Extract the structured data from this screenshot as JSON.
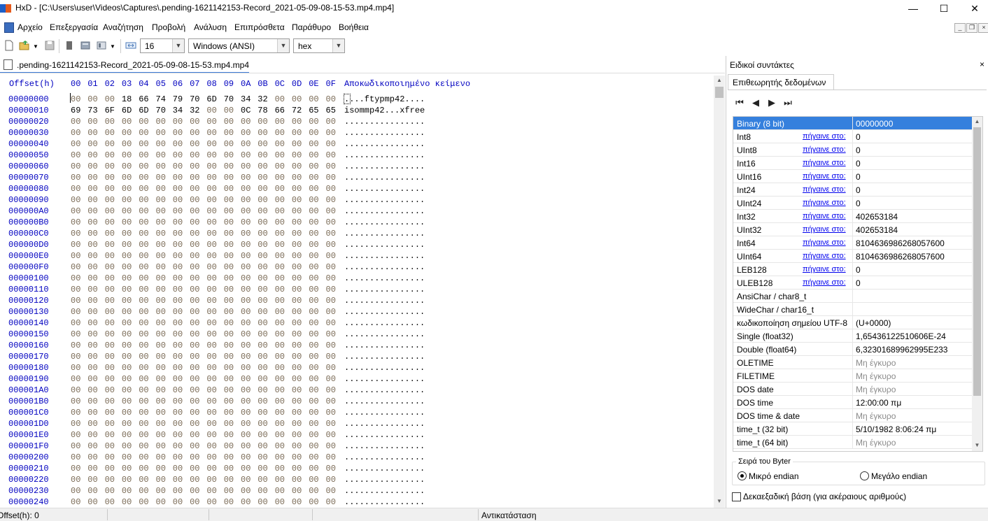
{
  "window": {
    "app_icon": "HxD",
    "title": "HxD - [C:\\Users\\user\\Videos\\Captures\\.pending-1621142153-Record_2021-05-09-08-15-53.mp4.mp4]",
    "minimize": "—",
    "maximize": "☐",
    "close": "✕"
  },
  "menu": [
    "Αρχείο",
    "Επεξεργασία",
    "Αναζήτηση",
    "Προβολή",
    "Ανάλυση",
    "Επιπρόσθετα",
    "Παράθυρο",
    "Βοήθεια"
  ],
  "toolbar": {
    "bytes_per_row": "16",
    "charset": "Windows (ANSI)",
    "offset_base": "hex",
    "icons": [
      "new-file-icon",
      "open-file-icon",
      "save-icon",
      "read-only-icon",
      "disk-icon",
      "ram-icon",
      "columns-icon"
    ]
  },
  "file_tab": ".pending-1621142153-Record_2021-05-09-08-15-53.mp4.mp4",
  "hex_editor": {
    "offset_header": "Offset(h)",
    "column_headers": [
      "00",
      "01",
      "02",
      "03",
      "04",
      "05",
      "06",
      "07",
      "08",
      "09",
      "0A",
      "0B",
      "0C",
      "0D",
      "0E",
      "0F"
    ],
    "decoded_header": "Αποκωδικοποιημένο κείμενο",
    "rows": [
      {
        "offset": "00000000",
        "bytes": [
          "00",
          "00",
          "00",
          "18",
          "66",
          "74",
          "79",
          "70",
          "6D",
          "70",
          "34",
          "32",
          "00",
          "00",
          "00",
          "00"
        ],
        "text": "....ftypmp42...."
      },
      {
        "offset": "00000010",
        "bytes": [
          "69",
          "73",
          "6F",
          "6D",
          "6D",
          "70",
          "34",
          "32",
          "00",
          "00",
          "0C",
          "78",
          "66",
          "72",
          "65",
          "65"
        ],
        "text": "isommp42...xfree"
      },
      {
        "offset": "00000020"
      },
      {
        "offset": "00000030"
      },
      {
        "offset": "00000040"
      },
      {
        "offset": "00000050"
      },
      {
        "offset": "00000060"
      },
      {
        "offset": "00000070"
      },
      {
        "offset": "00000080"
      },
      {
        "offset": "00000090"
      },
      {
        "offset": "000000A0"
      },
      {
        "offset": "000000B0"
      },
      {
        "offset": "000000C0"
      },
      {
        "offset": "000000D0"
      },
      {
        "offset": "000000E0"
      },
      {
        "offset": "000000F0"
      },
      {
        "offset": "00000100"
      },
      {
        "offset": "00000110"
      },
      {
        "offset": "00000120"
      },
      {
        "offset": "00000130"
      },
      {
        "offset": "00000140"
      },
      {
        "offset": "00000150"
      },
      {
        "offset": "00000160"
      },
      {
        "offset": "00000170"
      },
      {
        "offset": "00000180"
      },
      {
        "offset": "00000190"
      },
      {
        "offset": "000001A0"
      },
      {
        "offset": "000001B0"
      },
      {
        "offset": "000001C0"
      },
      {
        "offset": "000001D0"
      },
      {
        "offset": "000001E0"
      },
      {
        "offset": "000001F0"
      },
      {
        "offset": "00000200"
      },
      {
        "offset": "00000210"
      },
      {
        "offset": "00000220"
      },
      {
        "offset": "00000230"
      },
      {
        "offset": "00000240"
      }
    ],
    "empty_byte": "00",
    "empty_text": "................"
  },
  "status": {
    "offset": "Offset(h): 0",
    "mode": "Αντικατάσταση"
  },
  "tools_panel": {
    "title": "Ειδικοί συντάκτες",
    "close": "×",
    "tab": "Επιθεωρητής δεδομένων",
    "nav": [
      "⏮",
      "◀",
      "▶",
      "⏭"
    ],
    "rows": [
      {
        "name": "Binary (8 bit)",
        "link": "",
        "value": "00000000",
        "selected": true
      },
      {
        "name": "Int8",
        "link": "πήγαινε στο:",
        "value": "0"
      },
      {
        "name": "UInt8",
        "link": "πήγαινε στο:",
        "value": "0"
      },
      {
        "name": "Int16",
        "link": "πήγαινε στο:",
        "value": "0"
      },
      {
        "name": "UInt16",
        "link": "πήγαινε στο:",
        "value": "0"
      },
      {
        "name": "Int24",
        "link": "πήγαινε στο:",
        "value": "0"
      },
      {
        "name": "UInt24",
        "link": "πήγαινε στο:",
        "value": "0"
      },
      {
        "name": "Int32",
        "link": "πήγαινε στο:",
        "value": "402653184"
      },
      {
        "name": "UInt32",
        "link": "πήγαινε στο:",
        "value": "402653184"
      },
      {
        "name": "Int64",
        "link": "πήγαινε στο:",
        "value": "8104636986268057600"
      },
      {
        "name": "UInt64",
        "link": "πήγαινε στο:",
        "value": "8104636986268057600"
      },
      {
        "name": "LEB128",
        "link": "πήγαινε στο:",
        "value": "0"
      },
      {
        "name": "ULEB128",
        "link": "πήγαινε στο:",
        "value": "0"
      },
      {
        "name": "AnsiChar / char8_t",
        "link": "",
        "value": ""
      },
      {
        "name": "WideChar / char16_t",
        "link": "",
        "value": ""
      },
      {
        "name": "κωδικοποίηση σημείου UTF-8",
        "link": "",
        "value": "   (U+0000)"
      },
      {
        "name": "Single (float32)",
        "link": "",
        "value": "1,65436122510606E-24"
      },
      {
        "name": "Double (float64)",
        "link": "",
        "value": "6,32301689962995E233"
      },
      {
        "name": "OLETIME",
        "link": "",
        "value": "Μη έγκυρο",
        "invalid": true
      },
      {
        "name": "FILETIME",
        "link": "",
        "value": "Μη έγκυρο",
        "invalid": true
      },
      {
        "name": "DOS date",
        "link": "",
        "value": "Μη έγκυρο",
        "invalid": true
      },
      {
        "name": "DOS time",
        "link": "",
        "value": "12:00:00 πμ"
      },
      {
        "name": "DOS time & date",
        "link": "",
        "value": "Μη έγκυρο",
        "invalid": true
      },
      {
        "name": "time_t (32 bit)",
        "link": "",
        "value": "5/10/1982 8:06:24 πμ"
      },
      {
        "name": "time_t (64 bit)",
        "link": "",
        "value": "Μη έγκυρο",
        "invalid": true
      }
    ],
    "byte_order_label": "Σειρά του Byter",
    "little_endian": "Μικρό endian",
    "big_endian": "Μεγάλο endian",
    "little_endian_selected": true,
    "hex_base_label": "Δεκαεξαδική βάση (για ακέραιους αριθμούς)",
    "hex_base_checked": false
  }
}
